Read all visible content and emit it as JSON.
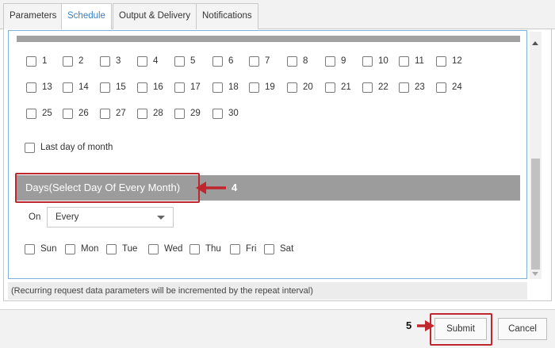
{
  "tabs": [
    {
      "label": "Parameters",
      "active": false
    },
    {
      "label": "Schedule",
      "active": true
    },
    {
      "label": "Output & Delivery",
      "active": false
    },
    {
      "label": "Notifications",
      "active": false
    }
  ],
  "dates": [
    "1",
    "2",
    "3",
    "4",
    "5",
    "6",
    "7",
    "8",
    "9",
    "10",
    "11",
    "12",
    "13",
    "14",
    "15",
    "16",
    "17",
    "18",
    "19",
    "20",
    "21",
    "22",
    "23",
    "24",
    "25",
    "26",
    "27",
    "28",
    "29",
    "30"
  ],
  "last_day_label": "Last day of month",
  "days_section": {
    "title": "Days(Select Day Of Every Month)",
    "callout": "4",
    "on_label": "On",
    "on_value": "Every",
    "weekdays": [
      "Sun",
      "Mon",
      "Tue",
      "Wed",
      "Thu",
      "Fri",
      "Sat"
    ]
  },
  "footer_note": "(Recurring request data parameters will be incremented by the repeat interval)",
  "actions": {
    "submit_label": "Submit",
    "cancel_label": "Cancel",
    "callout": "5"
  },
  "colors": {
    "accent_red": "#c0262d",
    "active_tab_text": "#3a7fc1",
    "section_bar": "#9c9c9c"
  },
  "icons": {
    "select_caret": "chevron-down-icon",
    "callout_arrow": "arrow-left-icon",
    "scroll_up": "triangle-up-icon",
    "scroll_down": "triangle-down-icon"
  }
}
